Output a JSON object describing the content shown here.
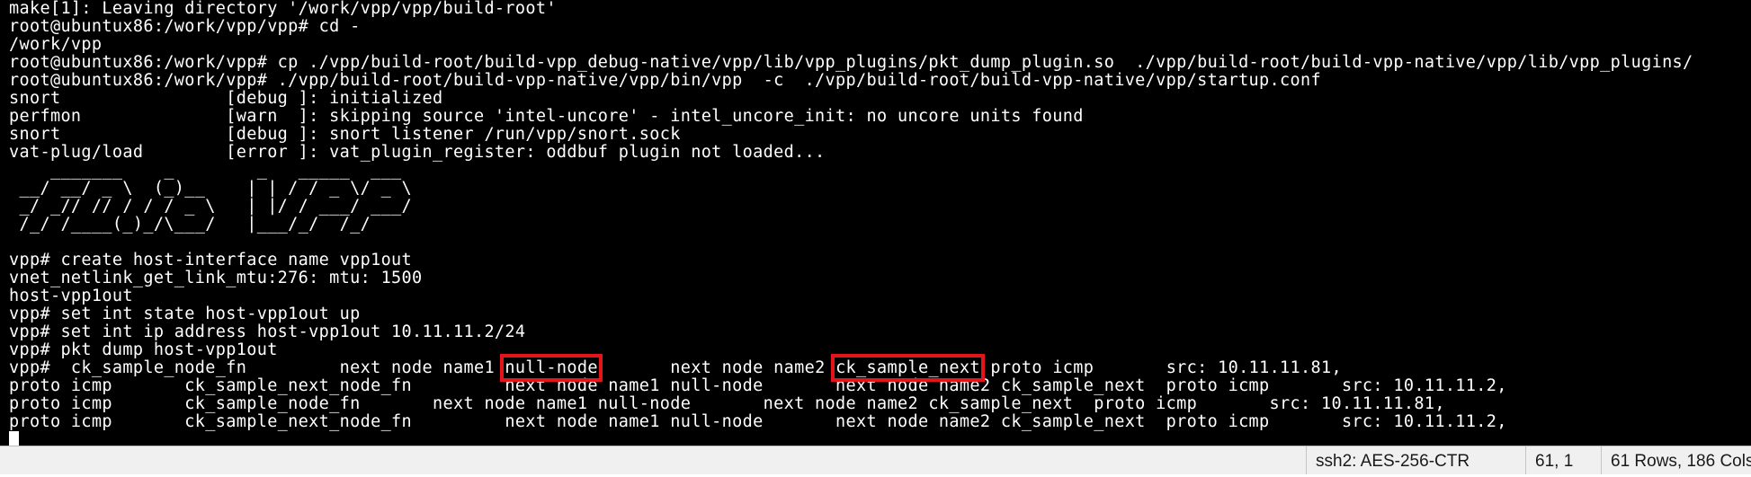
{
  "terminal": {
    "lines": [
      {
        "text": "make[1]: Leaving directory '/work/vpp/vpp/build-root'"
      },
      {
        "text": "root@ubuntux86:/work/vpp/vpp# cd -"
      },
      {
        "text": "/work/vpp"
      },
      {
        "text": "root@ubuntux86:/work/vpp# cp ./vpp/build-root/build-vpp_debug-native/vpp/lib/vpp_plugins/pkt_dump_plugin.so  ./vpp/build-root/build-vpp-native/vpp/lib/vpp_plugins/"
      },
      {
        "text": "root@ubuntux86:/work/vpp# ./vpp/build-root/build-vpp-native/vpp/bin/vpp  -c  ./vpp/build-root/build-vpp-native/vpp/startup.conf"
      },
      {
        "text": "snort                [debug ]: initialized"
      },
      {
        "text": "perfmon              [warn  ]: skipping source 'intel-uncore' - intel_uncore_init: no uncore units found"
      },
      {
        "text": "snort                [debug ]: snort listener /run/vpp/snort.sock"
      },
      {
        "text": "vat-plug/load        [error ]: vat_plugin_register: oddbuf plugin not loaded..."
      },
      {
        "text": "    _______    _        _   _____  ___ "
      },
      {
        "text": " __/ __/ _ \\  (_)__    | | / / _ \\/ _ \\"
      },
      {
        "text": " _/ _// // / / / _ \\   | |/ / ___/ ___/"
      },
      {
        "text": " /_/ /____(_)_/\\___/   |___/_/  /_/    "
      },
      {
        "text": ""
      },
      {
        "text": "vpp# create host-interface name vpp1out"
      },
      {
        "text": "vnet_netlink_get_link_mtu:276: mtu: 1500"
      },
      {
        "text": "host-vpp1out"
      },
      {
        "text": "vpp# set int state host-vpp1out up"
      },
      {
        "text": "vpp# set int ip address host-vpp1out 10.11.11.2/24"
      },
      {
        "text": "vpp# pkt dump host-vpp1out"
      },
      {
        "parts": [
          {
            "text": "vpp#  ck_sample_node_fn         next node name1 "
          },
          {
            "text": "null-node",
            "highlight": true
          },
          {
            "text": "       next node name2 "
          },
          {
            "text": "ck_sample_next",
            "highlight": true
          },
          {
            "text": " proto icmp       src: 10.11.11.81,"
          }
        ]
      },
      {
        "text": "proto icmp       ck_sample_next_node_fn         next node name1 null-node       next node name2 ck_sample_next  proto icmp       src: 10.11.11.2,"
      },
      {
        "text": "proto icmp       ck_sample_node_fn       next node name1 null-node       next node name2 ck_sample_next  proto icmp       src: 10.11.11.81,"
      },
      {
        "text": "proto icmp       ck_sample_next_node_fn         next node name1 null-node       next node name2 ck_sample_next  proto icmp       src: 10.11.11.2,"
      }
    ],
    "colors": {
      "background": "#000000",
      "foreground": "#ffffff",
      "highlight_box": "#e5141b"
    }
  },
  "status_bar": {
    "encryption": "ssh2: AES-256-CTR",
    "cursor_position": "61,  1",
    "size": "61 Rows, 186 Cols"
  }
}
